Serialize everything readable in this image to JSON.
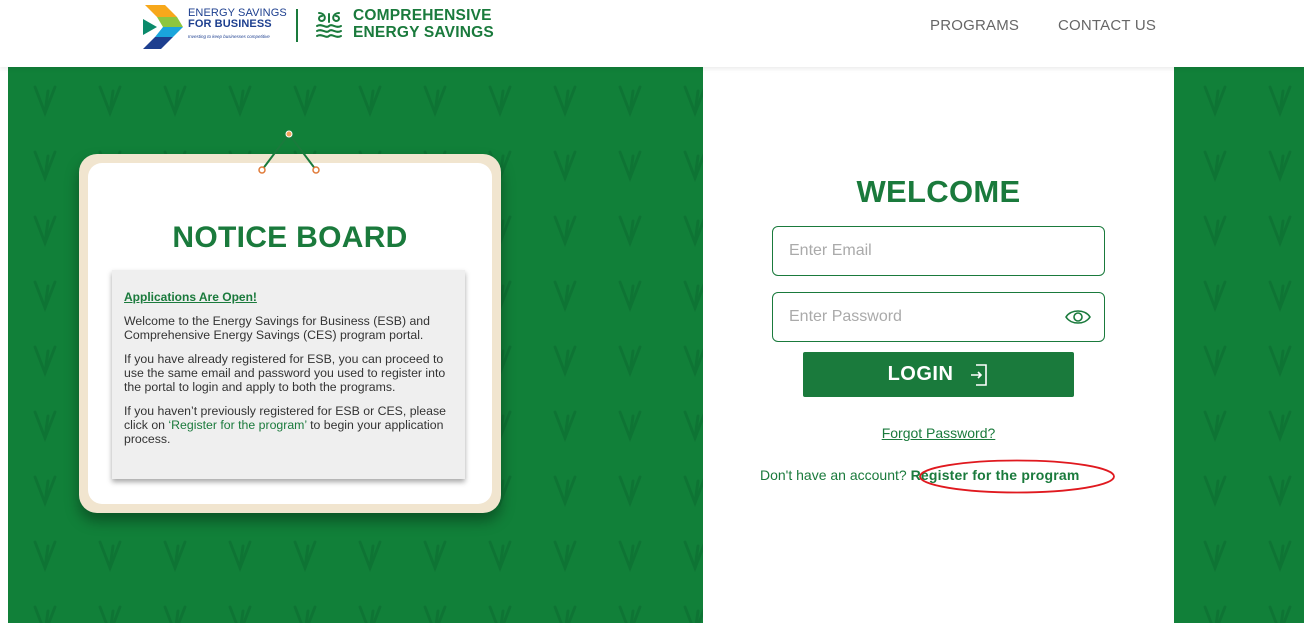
{
  "header": {
    "esb_logo": {
      "line1": "ENERGY SAVINGS",
      "line2": "FOR BUSINESS",
      "tagline": "Investing to keep businesses competitive"
    },
    "ces_logo": {
      "line1": "COMPREHENSIVE",
      "line2": "ENERGY SAVINGS"
    },
    "nav": {
      "programs": "PROGRAMS",
      "contact": "CONTACT US"
    }
  },
  "notice_board": {
    "title": "NOTICE BOARD",
    "heading": "Applications Are Open!",
    "paragraph1": "Welcome to the Energy Savings for Business (ESB) and Comprehensive Energy Savings (CES) program portal.",
    "paragraph2": "If you have already registered for ESB, you can proceed to use the same email and password you used to register into the portal to login and apply to both the programs.",
    "paragraph3_before": "If you haven’t previously registered for ESB or CES, please click on ",
    "paragraph3_link": "‘Register for the program’",
    "paragraph3_after": " to begin your application process."
  },
  "login": {
    "welcome": "WELCOME",
    "email_placeholder": "Enter Email",
    "password_placeholder": "Enter Password",
    "login_label": "LOGIN",
    "forgot_password": "Forgot Password?",
    "no_account_text": "Don't have an account? ",
    "register_link": "Register for the program"
  },
  "colors": {
    "brand_green": "#1a7a3c",
    "background_green": "#118039",
    "board_frame": "#f1e5cf",
    "annotation_red": "#e0191f"
  },
  "icons": {
    "password_toggle": "eye-icon",
    "login": "login-arrow-icon",
    "ces_logo": "swirl-leaf-icon"
  }
}
